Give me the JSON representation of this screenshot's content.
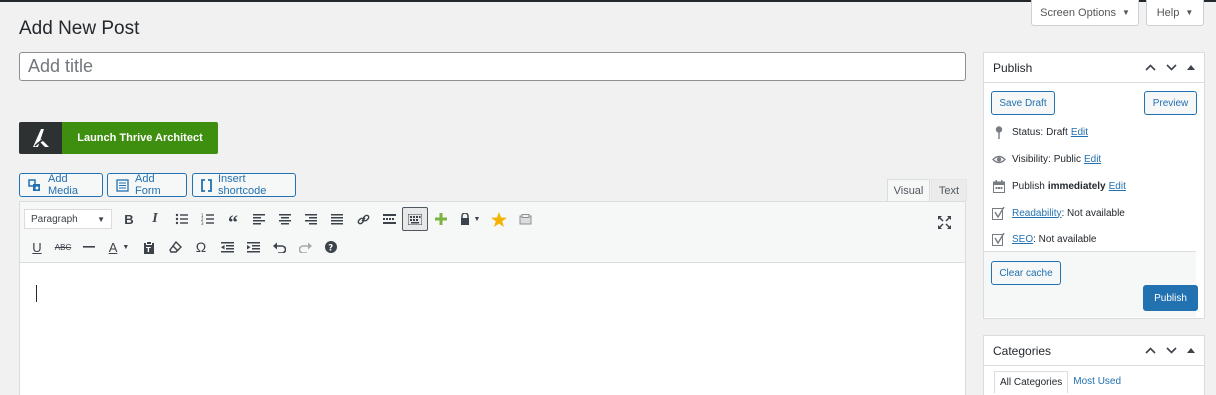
{
  "header": {
    "screen_options_label": "Screen Options",
    "help_label": "Help",
    "page_title": "Add New Post"
  },
  "title_field": {
    "placeholder": "Add title",
    "value": ""
  },
  "thrive": {
    "label": "Launch Thrive Architect"
  },
  "media_buttons": {
    "add_media": "Add Media",
    "add_form": "Add Form",
    "insert_shortcode": "Insert shortcode"
  },
  "editor": {
    "tabs": {
      "visual": "Visual",
      "text": "Text"
    },
    "format_select": "Paragraph",
    "toolbar_row1": [
      "bold-icon",
      "italic-icon",
      "bullet-list-icon",
      "numbered-list-icon",
      "blockquote-icon",
      "align-left-icon",
      "align-center-icon",
      "align-right-icon",
      "align-justify-icon",
      "link-icon",
      "toolbar-toggle-icon",
      "plus-icon",
      "lock-icon",
      "star-icon",
      "box-icon"
    ],
    "toolbar_row2": [
      "underline-icon",
      "strikethrough-icon",
      "horizontal-line-icon",
      "text-color-icon",
      "paste-text-icon",
      "clear-formatting-icon",
      "special-character-icon",
      "outdent-icon",
      "indent-icon",
      "undo-icon",
      "redo-icon",
      "help-icon"
    ],
    "content": ""
  },
  "publish_box": {
    "title": "Publish",
    "save_draft": "Save Draft",
    "preview": "Preview",
    "status_label": "Status:",
    "status_value": "Draft",
    "visibility_label": "Visibility:",
    "visibility_value": "Public",
    "publish_text": "Publish",
    "publish_value": "immediately",
    "edit_link": "Edit",
    "readability_link": "Readability",
    "readability_value": ": Not available",
    "seo_link": "SEO",
    "seo_value": ": Not available",
    "clear_cache": "Clear cache",
    "publish_button": "Publish"
  },
  "categories_box": {
    "title": "Categories",
    "tab_all": "All Categories",
    "tab_most_used": "Most Used"
  },
  "colors": {
    "accent": "#2271b1",
    "thrive_green": "#3e8f0f",
    "thrive_dark": "#2d3132",
    "background": "#f1f1f1"
  }
}
